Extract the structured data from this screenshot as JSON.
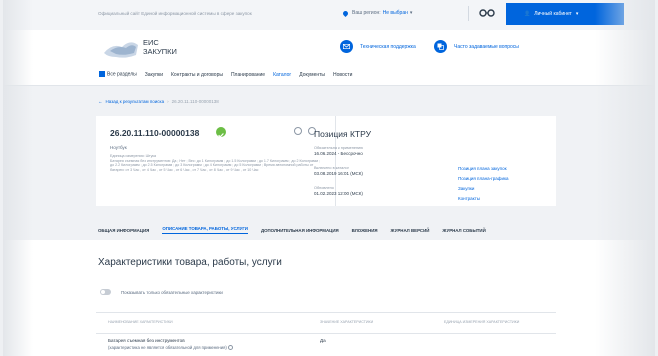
{
  "topbar": {
    "site_label": "Официальный сайт Единой информационной системы в сфере закупок",
    "region_prefix": "Ваш регион:",
    "region_value": "Не выбран",
    "cabinet_label": "Личный кабинет"
  },
  "header": {
    "logo_line1": "ЕИС",
    "logo_line2": "ЗАКУПКИ",
    "support_label": "Техническая поддержка",
    "faq_label": "Часто задаваемые вопросы"
  },
  "nav": {
    "items": [
      "Все разделы",
      "Закупки",
      "Контракты и договоры",
      "Планирование",
      "Каталог",
      "Документы",
      "Новости"
    ]
  },
  "breadcrumb": {
    "back_label": "Назад к результатам поиска",
    "current": "26.20.11.110-00000138"
  },
  "card": {
    "code": "26.20.11.110-00000138",
    "name": "Ноутбук",
    "description": "Единица измерения: Штука\nБатарея съемная без инструментов: Да ; Нет ; Вес: до 1 Килограмм ; до 1.5 Килограмм ; до 1.7 Килограмм ; до 2 Килограмм ; до 2.2 Килограмм ; до 2.5 Килограмм ; до 3 Килограмм ; до 4 Килограмм ; до 5 Килограмм ; Время автономной работы от батареи: от 3 Час , от 4 Час , от 5 Час , от 6 Час , от 7 Час , от 8 Час , от 9 Час , от 10 Час",
    "position_title": "Позиция КТРУ",
    "meta": [
      {
        "label": "Обязательна к применению",
        "value": "16.06.2024 - Бессрочно"
      },
      {
        "label": "Включено в каталог",
        "value": "03.08.2019 16:01 (МСК)"
      },
      {
        "label": "Обновлено",
        "value": "01.02.2023 12:00 (МСК)"
      }
    ],
    "links": [
      "Позиция плана закупок",
      "Позиция плана-графика",
      "Закупки",
      "Контракты"
    ]
  },
  "tabs": [
    {
      "label": "ОБЩАЯ ИНФОРМАЦИЯ",
      "active": false
    },
    {
      "label": "ОПИСАНИЕ ТОВАРА, РАБОТЫ, УСЛУГИ",
      "active": true
    },
    {
      "label": "ДОПОЛНИТЕЛЬНАЯ ИНФОРМАЦИЯ",
      "active": false
    },
    {
      "label": "ВЛОЖЕНИЯ",
      "active": false
    },
    {
      "label": "ЖУРНАЛ ВЕРСИЙ",
      "active": false
    },
    {
      "label": "ЖУРНАЛ СОБЫТИЙ",
      "active": false
    }
  ],
  "content": {
    "title": "Характеристики товара, работы, услуги",
    "toggle_label": "Показывать только обязательные характеристики",
    "columns": [
      "НАИМЕНОВАНИЕ ХАРАКТЕРИСТИКИ",
      "ЗНАЧЕНИЕ ХАРАКТЕРИСТИКИ",
      "ЕДИНИЦА ИЗМЕРЕНИЯ ХАРАКТЕРИСТИКИ"
    ],
    "rows": [
      {
        "name": "Батарея съемная без инструментов",
        "note": "(характеристика не является обязательной для применения)",
        "value": "Да"
      }
    ]
  },
  "colors": {
    "accent": "#0065dd",
    "ok": "#6cbe45"
  }
}
